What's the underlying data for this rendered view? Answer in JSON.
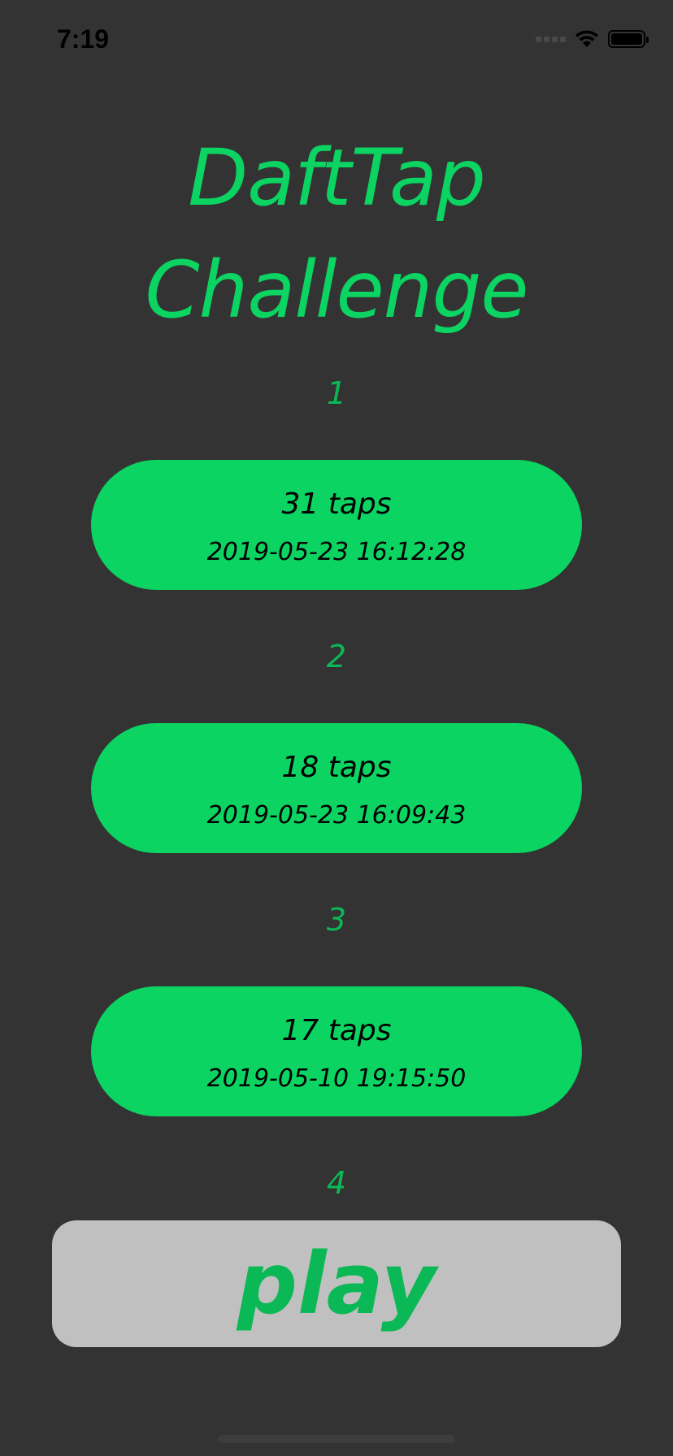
{
  "status_bar": {
    "time": "7:19"
  },
  "title": {
    "line1": "DaftTap",
    "line2": "Challenge"
  },
  "leaderboard": [
    {
      "rank": "1",
      "taps": "31  taps",
      "date": "2019-05-23 16:12:28"
    },
    {
      "rank": "2",
      "taps": "18  taps",
      "date": "2019-05-23 16:09:43"
    },
    {
      "rank": "3",
      "taps": "17  taps",
      "date": "2019-05-10 19:15:50"
    },
    {
      "rank": "4"
    }
  ],
  "play_button": {
    "label": "play"
  },
  "colors": {
    "background": "#333333",
    "accent_green": "#0bd462",
    "rank_green": "#0bb856",
    "play_button_bg": "#c0c0c0"
  }
}
